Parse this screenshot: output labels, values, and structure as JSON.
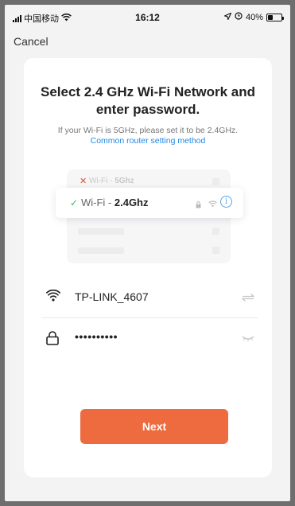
{
  "status_bar": {
    "carrier": "中国移动",
    "time": "16:12",
    "battery_percent": "40%",
    "battery_level": 0.4,
    "icons": [
      "signal-icon",
      "wifi-icon",
      "location-icon",
      "alarm-icon",
      "battery-icon"
    ]
  },
  "nav": {
    "cancel_label": "Cancel"
  },
  "content": {
    "title": "Select 2.4 GHz Wi-Fi Network and enter password.",
    "hint": "If your Wi-Fi is 5GHz, please set it to be 2.4GHz.",
    "router_link": "Common router setting method"
  },
  "illustration": {
    "bad_prefix": "Wi-Fi - ",
    "bad_band": "5Ghz",
    "good_prefix": "Wi-Fi - ",
    "good_band": "2.4Ghz",
    "info_glyph": "i"
  },
  "form": {
    "ssid_value": "TP-LINK_4607",
    "password_value": "••••••••••"
  },
  "actions": {
    "next_label": "Next"
  },
  "colors": {
    "accent": "#ed6b3e",
    "link": "#1f89e6",
    "success": "#49b46a",
    "error": "#e04b3a"
  }
}
